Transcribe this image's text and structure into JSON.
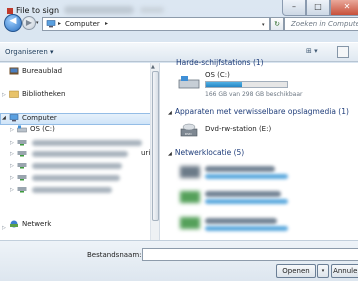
{
  "window": {
    "title": "File to sign",
    "minimize_glyph": "–",
    "maximize_glyph": "□",
    "close_glyph": "✕"
  },
  "address_bar": {
    "back_glyph": "◀",
    "forward_glyph": "▶",
    "dropdown_glyph": "▾",
    "crumb_separator": "▸",
    "location": "Computer",
    "refresh_glyph": "↻",
    "search_placeholder": "Zoeken in Computer"
  },
  "toolbar": {
    "organize_label": "Organiseren ▾",
    "view_label": "⊞ ▾"
  },
  "navigation": {
    "desktop": "Bureaublad",
    "libraries": "Bibliotheken",
    "computer": "Computer",
    "os_drive": "OS (C:)",
    "network": "Netwerk",
    "partial_text": "uric"
  },
  "content": {
    "hard_disks_header": "Harde-schijfstations (1)",
    "drive_c": {
      "label": "OS (C:)",
      "free_text": "166 GB van 298 GB beschikbaar",
      "used_fraction": 0.44
    },
    "removable_header": "Apparaten met verwisselbare opslagmedia (1)",
    "dvd_label": "Dvd-rw-station (E:)",
    "network_header": "Netwerklocatie (5)"
  },
  "footer": {
    "filename_label": "Bestandsnaam:",
    "open_label": "Openen",
    "open_drop_glyph": "▾",
    "cancel_label": "Annuleren"
  },
  "colors": {
    "accent": "#2686c4",
    "header_text": "#1f3d7a"
  }
}
